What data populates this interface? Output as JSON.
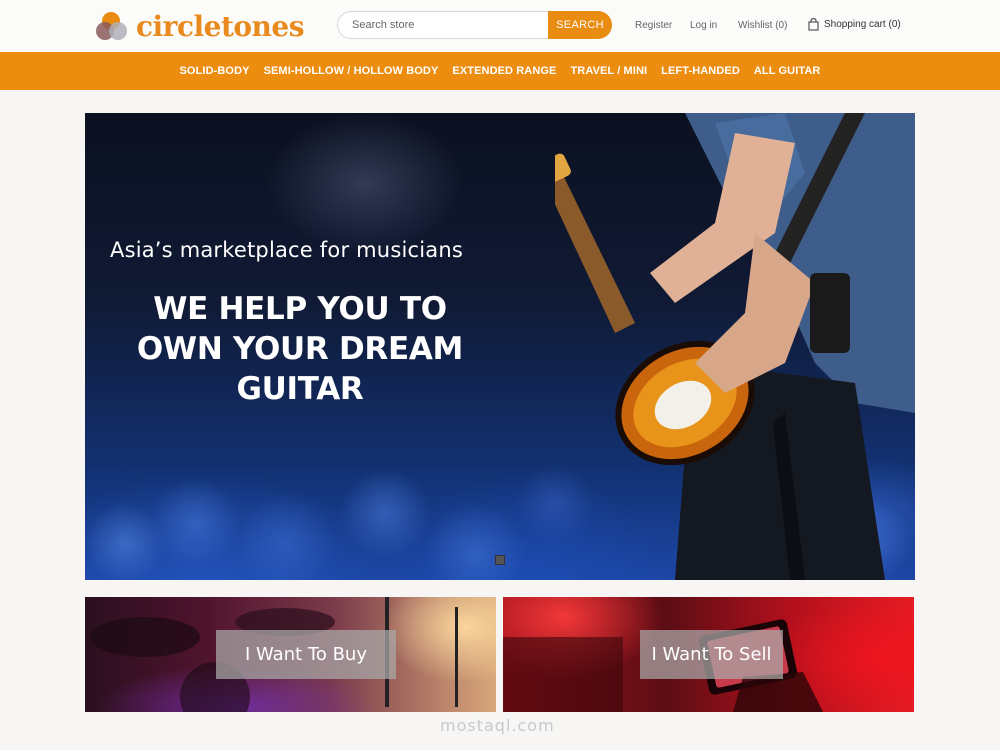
{
  "brand": {
    "name": "circletones",
    "accent": "#e98c12"
  },
  "search": {
    "placeholder": "Search store",
    "button_label": "SEARCH"
  },
  "header_links": {
    "register": "Register",
    "login": "Log in",
    "wishlist": "Wishlist (0)",
    "cart": "Shopping cart (0)"
  },
  "nav": {
    "items": [
      {
        "label": "SOLID-BODY"
      },
      {
        "label": "SEMI-HOLLOW / HOLLOW BODY"
      },
      {
        "label": "EXTENDED RANGE"
      },
      {
        "label": "TRAVEL / MINI"
      },
      {
        "label": "LEFT-HANDED"
      },
      {
        "label": "ALL GUITAR"
      }
    ]
  },
  "hero": {
    "subtitle": "Asia’s marketplace for musicians",
    "title": "WE HELP YOU TO OWN YOUR DREAM GUITAR"
  },
  "tiles": {
    "buy_label": "I Want To Buy",
    "sell_label": "I Want To Sell"
  },
  "watermark": "mostaql.com",
  "icons": {
    "cart": "shopping-bag-icon",
    "logo": "circles-logo-icon"
  }
}
